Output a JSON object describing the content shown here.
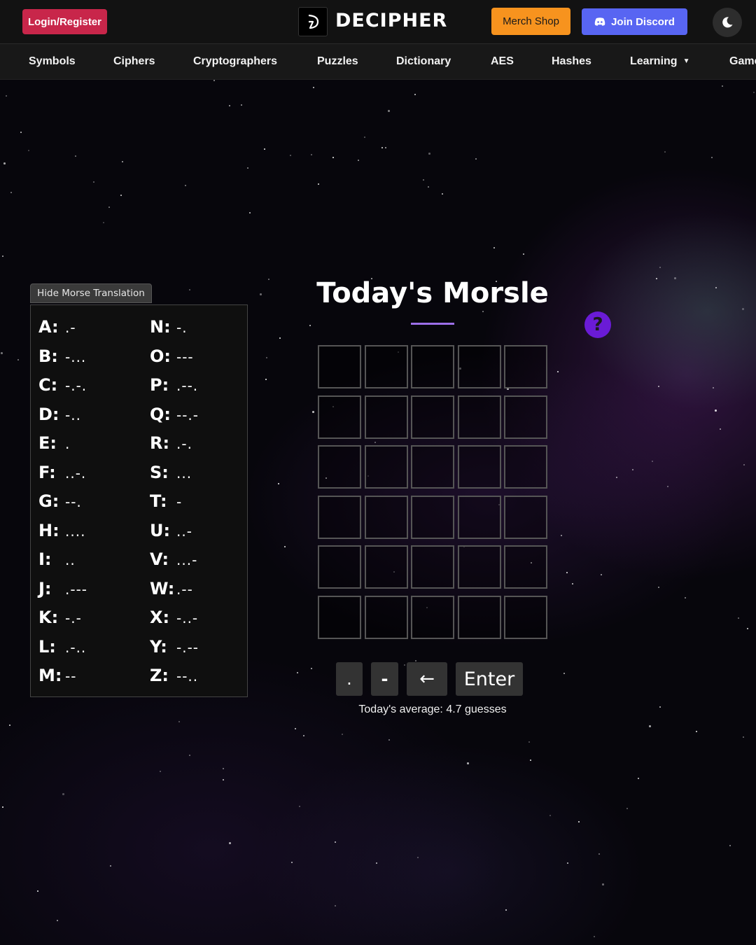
{
  "header": {
    "login_label": "Login/Register",
    "logo_text": "DECIPHER",
    "merch_label": "Merch Shop",
    "discord_label": "Join Discord"
  },
  "nav": {
    "items": [
      "Symbols",
      "Ciphers",
      "Cryptographers",
      "Puzzles",
      "Dictionary",
      "AES",
      "Hashes",
      "Learning",
      "Games"
    ]
  },
  "morse": {
    "toggle_label": "Hide Morse Translation",
    "left": [
      {
        "letter": "A:",
        "code": ".-"
      },
      {
        "letter": "B:",
        "code": "-..."
      },
      {
        "letter": "C:",
        "code": "-.-."
      },
      {
        "letter": "D:",
        "code": "-.."
      },
      {
        "letter": "E:",
        "code": "."
      },
      {
        "letter": "F:",
        "code": "..-."
      },
      {
        "letter": "G:",
        "code": "--."
      },
      {
        "letter": "H:",
        "code": "...."
      },
      {
        "letter": "I:",
        "code": ".."
      },
      {
        "letter": "J:",
        "code": ".---"
      },
      {
        "letter": "K:",
        "code": "-.-"
      },
      {
        "letter": "L:",
        "code": ".-.."
      },
      {
        "letter": "M:",
        "code": "--"
      }
    ],
    "right": [
      {
        "letter": "N:",
        "code": "-."
      },
      {
        "letter": "O:",
        "code": "---"
      },
      {
        "letter": "P:",
        "code": ".--."
      },
      {
        "letter": "Q:",
        "code": "--.-"
      },
      {
        "letter": "R:",
        "code": ".-."
      },
      {
        "letter": "S:",
        "code": "..."
      },
      {
        "letter": "T:",
        "code": "-"
      },
      {
        "letter": "U:",
        "code": "..-"
      },
      {
        "letter": "V:",
        "code": "...-"
      },
      {
        "letter": "W:",
        "code": ".--"
      },
      {
        "letter": "X:",
        "code": "-..-"
      },
      {
        "letter": "Y:",
        "code": "-.--"
      },
      {
        "letter": "Z:",
        "code": "--.."
      }
    ]
  },
  "game": {
    "title": "Today's Morsle",
    "help_label": "?",
    "keys": {
      "dot": ".",
      "dash": "-",
      "back": "←",
      "enter": "Enter"
    },
    "average_text": "Today's average: 4.7 guesses"
  },
  "colors": {
    "login": "#c8264a",
    "merch": "#f7931e",
    "discord": "#5865f2",
    "help": "#6a1bd6",
    "underline": "#9b6ee8"
  },
  "icons": [
    "logo-icon",
    "discord-icon",
    "moon-icon",
    "help-icon",
    "caret-down-icon"
  ]
}
